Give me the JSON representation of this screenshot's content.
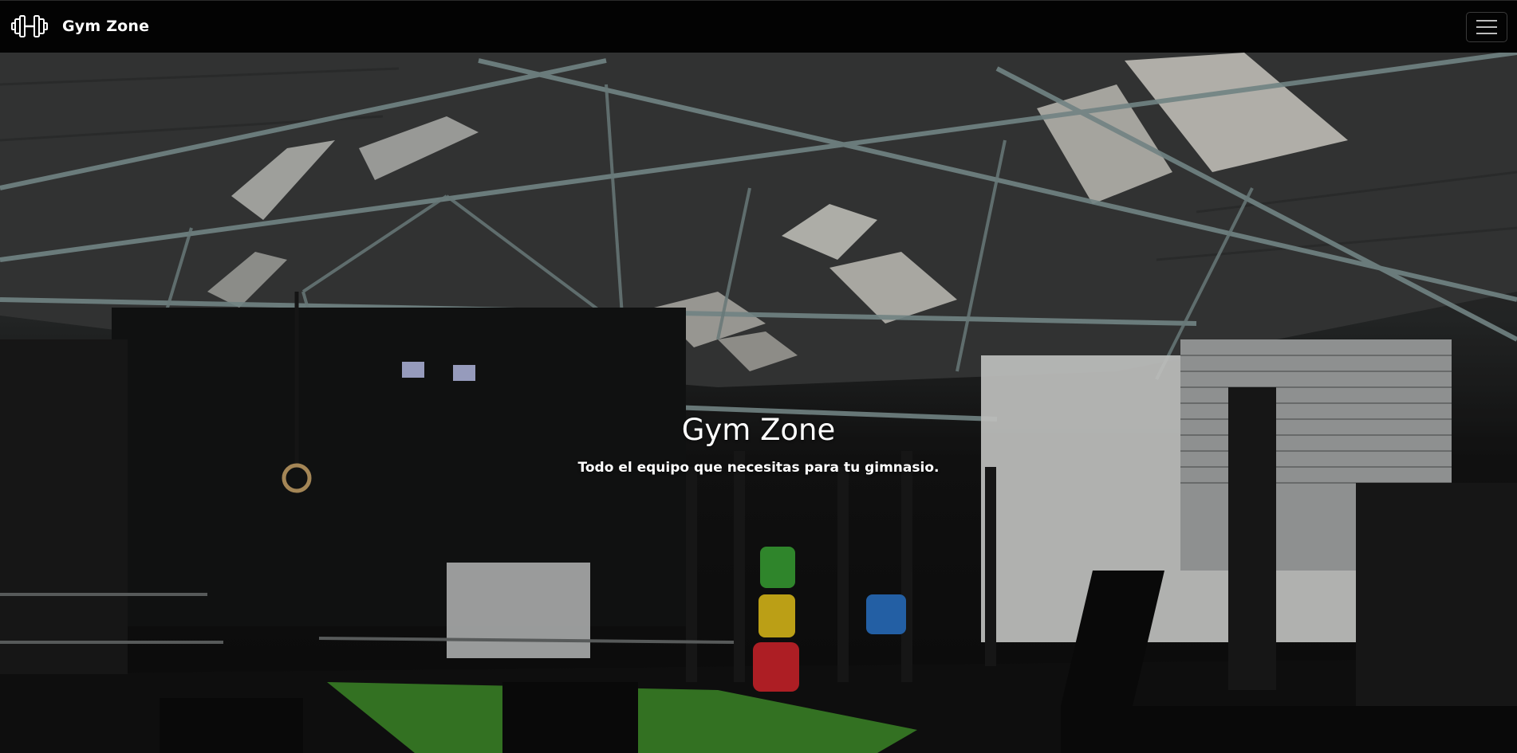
{
  "navbar": {
    "brand_text": "Gym Zone",
    "brand_icon": "dumbbell-icon",
    "menu_icon": "hamburger-menu-icon"
  },
  "hero": {
    "title": "Gym Zone",
    "subtitle": "Todo el equipo que necesitas para tu gimnasio.",
    "background_image": "gym-interior-photo"
  },
  "colors": {
    "navbar_background": "#030303",
    "hero_text": "#ffffff",
    "plate_green": "#3aa335",
    "plate_yellow": "#e5c21b",
    "plate_red": "#d4252c",
    "plate_blue": "#2b74c9",
    "turf_green": "#3f8a2a"
  }
}
